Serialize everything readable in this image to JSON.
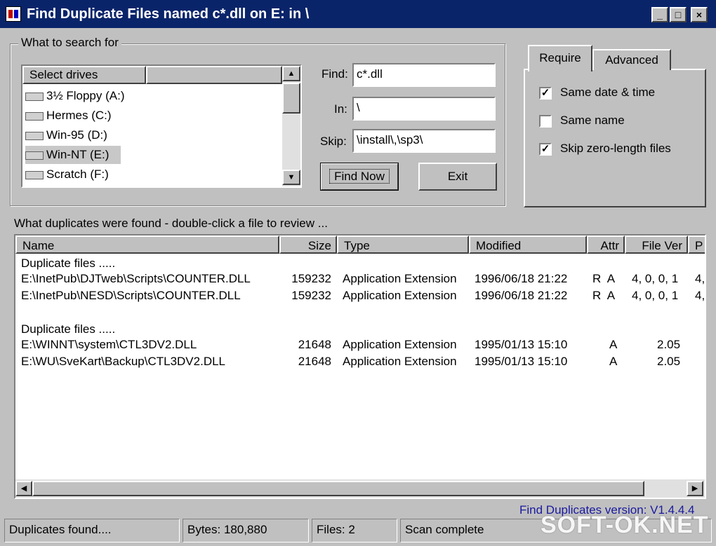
{
  "window": {
    "title": "Find Duplicate Files named c*.dll on E: in \\",
    "app_icon": "document-icon",
    "controls": {
      "minimize": "_",
      "maximize": "□",
      "close": "×"
    }
  },
  "search_group": {
    "legend": "What to search for",
    "drives_header": "Select drives",
    "drives": [
      {
        "label": "3½ Floppy (A:)",
        "icon": "floppy-drive-icon",
        "selected": false
      },
      {
        "label": "Hermes (C:)",
        "icon": "hard-drive-icon",
        "selected": false
      },
      {
        "label": "Win-95 (D:)",
        "icon": "hard-drive-icon",
        "selected": false
      },
      {
        "label": "Win-NT (E:)",
        "icon": "hard-drive-icon",
        "selected": true
      },
      {
        "label": "Scratch (F:)",
        "icon": "hard-drive-icon",
        "selected": false
      }
    ],
    "find_label": "Find:",
    "find_value": "c*.dll",
    "in_label": "In:",
    "in_value": "\\",
    "skip_label": "Skip:",
    "skip_value": "\\install\\,\\sp3\\",
    "find_now": "Find Now",
    "exit": "Exit"
  },
  "options": {
    "tabs": [
      "Require",
      "Advanced"
    ],
    "active_tab": "Require",
    "checks": [
      {
        "label": "Same date & time",
        "checked": true
      },
      {
        "label": "Same name",
        "checked": false
      },
      {
        "label": "Skip zero-length files",
        "checked": true
      }
    ]
  },
  "results": {
    "caption": "What duplicates were found - double-click a file to review ...",
    "columns": [
      "Name",
      "Size",
      "Type",
      "Modified",
      "Attr",
      "File Ver",
      "P"
    ],
    "groups": [
      {
        "header": "Duplicate files .....",
        "rows": [
          {
            "name": "E:\\InetPub\\DJTweb\\Scripts\\COUNTER.DLL",
            "size": "159232",
            "type": "Application Extension",
            "modified": "1996/06/18 21:22",
            "attr": "R  A",
            "ver": "4, 0, 0, 1",
            "p": "4,"
          },
          {
            "name": "E:\\InetPub\\NESD\\Scripts\\COUNTER.DLL",
            "size": "159232",
            "type": "Application Extension",
            "modified": "1996/06/18 21:22",
            "attr": "R  A",
            "ver": "4, 0, 0, 1",
            "p": "4,"
          }
        ]
      },
      {
        "header": "Duplicate files .....",
        "rows": [
          {
            "name": "E:\\WINNT\\system\\CTL3DV2.DLL",
            "size": "21648",
            "type": "Application Extension",
            "modified": "1995/01/13 15:10",
            "attr": "A",
            "ver": "2.05",
            "p": ""
          },
          {
            "name": "E:\\WU\\SveKart\\Backup\\CTL3DV2.DLL",
            "size": "21648",
            "type": "Application Extension",
            "modified": "1995/01/13 15:10",
            "attr": "A",
            "ver": "2.05",
            "p": ""
          }
        ]
      }
    ]
  },
  "version_text": "Find Duplicates version: V1.4.4.4",
  "status_bar": {
    "found": "Duplicates found....",
    "bytes": "Bytes: 180,880",
    "files": "Files: 2",
    "state": "Scan complete"
  },
  "watermark": "SOFT-OK.NET",
  "colors": {
    "titlebar": "#0a246a",
    "face": "#c0c0c0",
    "version_link": "#1a1aa0",
    "selection": "#c8c8c8"
  }
}
